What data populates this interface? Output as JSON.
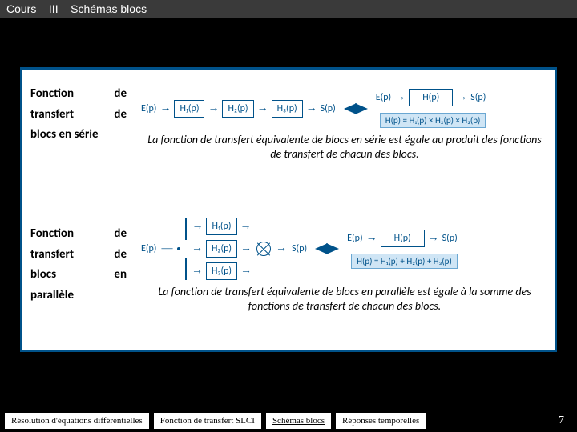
{
  "header": {
    "title": "Cours – III – Schémas blocs"
  },
  "section1": {
    "label": {
      "l1a": "Fonction",
      "l1b": "de",
      "l2a": "transfert",
      "l2b": "de",
      "l3": "blocs en série"
    },
    "left": {
      "in": "E(p)",
      "b1": "H₁(p)",
      "b2": "H₂(p)",
      "b3": "H₃(p)",
      "out": "S(p)"
    },
    "right": {
      "in": "E(p)",
      "b": "H(p)",
      "out": "S(p)"
    },
    "formula": "H(p) = H₁(p) × H₂(p) × H₃(p)",
    "caption": "La fonction de transfert équivalente de blocs en série est égale au produit des fonctions de transfert de chacun des blocs."
  },
  "section2": {
    "label": {
      "l1a": "Fonction",
      "l1b": "de",
      "l2a": "transfert",
      "l2b": "de",
      "l3a": "blocs",
      "l3b": "en",
      "l4": "parallèle"
    },
    "left": {
      "in": "E(p)",
      "b1": "H₁(p)",
      "b2": "H₂(p)",
      "b3": "H₃(p)",
      "out": "S(p)"
    },
    "right": {
      "in": "E(p)",
      "b": "H(p)",
      "out": "S(p)"
    },
    "formula": "H(p) = H₁(p) + H₂(p) + H₃(p)",
    "caption": "La fonction de transfert équivalente de blocs en parallèle est égale à la somme des fonctions de transfert de chacun des blocs."
  },
  "footer": {
    "buttons": [
      "Résolution d'équations différentielles",
      "Fonction de transfert SLCI",
      "Schémas blocs",
      "Réponses temporelles"
    ],
    "active_index": 2,
    "page": "7"
  }
}
